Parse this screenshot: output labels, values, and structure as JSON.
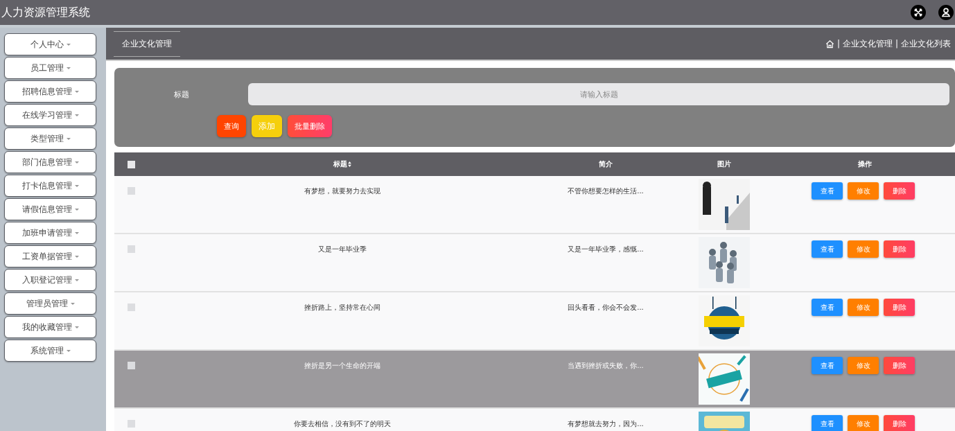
{
  "header": {
    "title": "人力资源管理系统"
  },
  "sidebar": {
    "items": [
      {
        "label": "个人中心",
        "expanded": false
      },
      {
        "label": "员工管理",
        "expanded": false
      },
      {
        "label": "招聘信息管理",
        "expanded": false
      },
      {
        "label": "在线学习管理",
        "expanded": false
      },
      {
        "label": "类型管理",
        "expanded": false
      },
      {
        "label": "部门信息管理",
        "expanded": false
      },
      {
        "label": "打卡信息管理",
        "expanded": false
      },
      {
        "label": "请假信息管理",
        "expanded": false
      },
      {
        "label": "加班申请管理",
        "expanded": false
      },
      {
        "label": "工资单据管理",
        "expanded": false
      },
      {
        "label": "入职登记管理",
        "expanded": false
      },
      {
        "label": "管理员管理",
        "expanded": false
      },
      {
        "label": "我的收藏管理",
        "expanded": false
      },
      {
        "label": "系统管理",
        "expanded": false
      }
    ]
  },
  "page_tab": "企业文化管理",
  "breadcrumb": {
    "separator": "|",
    "items": [
      "企业文化管理",
      "企业文化列表"
    ]
  },
  "search": {
    "label": "标题",
    "placeholder": "请输入标题"
  },
  "buttons": [
    {
      "label": "查询",
      "kind": "query"
    },
    {
      "label": "添加",
      "kind": "add"
    },
    {
      "label": "批量删除",
      "kind": "delete"
    }
  ],
  "table": {
    "columns": [
      "标题",
      "简介",
      "图片",
      "操作"
    ],
    "all_checked": false,
    "rows": [
      {
        "checked": false,
        "highlighted": false,
        "title": "有梦想，就要努力去实现",
        "intro": "不管你想要怎样的生活...",
        "image": {
          "kind": "picture"
        },
        "actions": [
          "查看",
          "修改",
          "删除"
        ]
      },
      {
        "checked": false,
        "highlighted": false,
        "title": "又是一年毕业季",
        "intro": "又是一年毕业季，感慨...",
        "image": {
          "kind": "picture"
        },
        "actions": [
          "查看",
          "修改",
          "删除"
        ]
      },
      {
        "checked": false,
        "highlighted": false,
        "title": "挫折路上，坚持常在心间",
        "intro": "回头看看，你会不会发...",
        "image": {
          "kind": "picture"
        },
        "actions": [
          "查看",
          "修改",
          "删除"
        ]
      },
      {
        "checked": false,
        "highlighted": true,
        "title": "挫折是另一个生命的开端",
        "intro": "当遇到挫折或失败，你...",
        "image": {
          "kind": "picture"
        },
        "actions": [
          "查看",
          "修改",
          "删除"
        ]
      },
      {
        "checked": false,
        "highlighted": false,
        "title": "你要去相信，没有到不了的明天",
        "intro": "有梦想就去努力，因为...",
        "image": {
          "kind": "picture"
        },
        "actions": [
          "查看",
          "修改",
          "删除"
        ]
      }
    ]
  }
}
